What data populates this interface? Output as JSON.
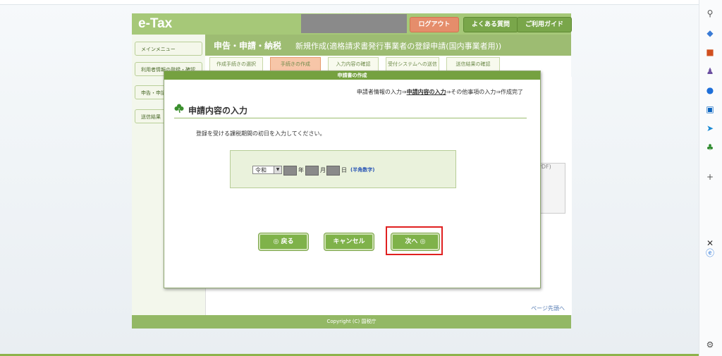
{
  "site": {
    "logo": "e-Tax",
    "header_buttons": {
      "logout": "ログアウト",
      "faq": "よくある質問",
      "guide": "ご利用ガイド"
    },
    "sidebar": [
      {
        "label": "メインメニュー"
      },
      {
        "label": "利用者情報の登録・確認"
      },
      {
        "label": "申告・申請"
      },
      {
        "label": "送信結果"
      }
    ],
    "title_main": "申告・申請・納税",
    "title_sub": "新規作成(適格請求書発行事業者の登録申請(国内事業者用))",
    "steps": [
      "作成手続きの選択",
      "手続きの作成",
      "入力内容の確認",
      "受付システムへの送信",
      "送信結果の確認"
    ],
    "pdf_label": "PDF)",
    "page_top": "ページ先頭へ",
    "footer": "Copyright (C) 国税庁"
  },
  "dialog": {
    "title": "申請書の作成",
    "breadcrumb": {
      "step1": "申請者情報の入力",
      "sep1": "⇒",
      "current": "申請内容の入力",
      "sep2": "⇒",
      "step3": "その他事項の入力",
      "sep3": "⇒",
      "step4": "作成完了"
    },
    "section_title": "申請内容の入力",
    "instruction": "登録を受ける課税期間の初日を入力してください。",
    "era_value": "令和",
    "unit_year": "年",
    "unit_month": "月",
    "unit_day": "日",
    "hint": "(半角数字)",
    "buttons": {
      "back": "◎ 戻る",
      "cancel": "キャンセル",
      "next": "次へ ◎"
    }
  },
  "colors": {
    "accent": "#7fb24a",
    "highlight": "#e02020"
  }
}
